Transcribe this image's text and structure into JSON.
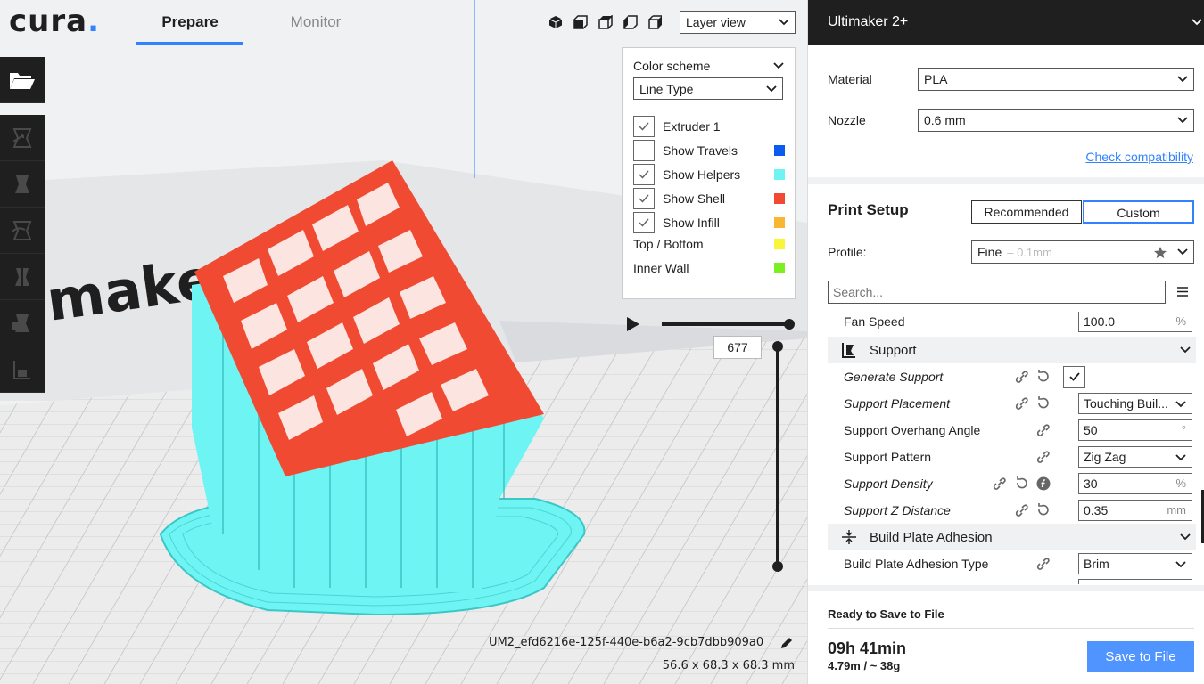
{
  "app": {
    "logo": "cura",
    "logo_dot": "."
  },
  "tabs": [
    {
      "label": "Prepare"
    },
    {
      "label": "Monitor"
    }
  ],
  "view": {
    "mode": "Layer view"
  },
  "legend": {
    "title": "Color scheme",
    "scheme": "Line Type",
    "items": [
      {
        "label": "Extruder 1",
        "checked": true,
        "color": ""
      },
      {
        "label": "Show Travels",
        "checked": false,
        "color": "#0a5cf0"
      },
      {
        "label": "Show Helpers",
        "checked": true,
        "color": "#6ff4f4"
      },
      {
        "label": "Show Shell",
        "checked": true,
        "color": "#f14a32"
      },
      {
        "label": "Show Infill",
        "checked": true,
        "color": "#f9b631"
      },
      {
        "label": "Top / Bottom",
        "checked": null,
        "color": "#f9f53a"
      },
      {
        "label": "Inner Wall",
        "checked": null,
        "color": "#7af021"
      }
    ]
  },
  "layer": {
    "current": "677"
  },
  "object": {
    "filename": "UM2_efd6216e-125f-440e-b6a2-9cb7dbb909a0",
    "dimensions": "56.6 x 68.3 x 68.3 mm"
  },
  "scene": {
    "plate_text": "maker"
  },
  "sidebar": {
    "machine": "Ultimaker 2+",
    "material_label": "Material",
    "material": "PLA",
    "nozzle_label": "Nozzle",
    "nozzle": "0.6 mm",
    "check_link": "Check compatibility",
    "print_setup": "Print Setup",
    "recommended": "Recommended",
    "custom": "Custom",
    "profile_label": "Profile:",
    "profile": "Fine",
    "profile_detail": "– 0.1mm",
    "search_placeholder": "Search...",
    "settings": [
      {
        "label": "Fan Speed",
        "value": "100.0",
        "unit": "%"
      },
      {
        "label": "Support"
      },
      {
        "label": "Generate Support"
      },
      {
        "label": "Support Placement",
        "value": "Touching Buil..."
      },
      {
        "label": "Support Overhang Angle",
        "value": "50",
        "unit": "°"
      },
      {
        "label": "Support Pattern",
        "value": "Zig Zag"
      },
      {
        "label": "Support Density",
        "value": "30",
        "unit": "%"
      },
      {
        "label": "Support Z Distance",
        "value": "0.35",
        "unit": "mm"
      },
      {
        "label": "Build Plate Adhesion"
      },
      {
        "label": "Build Plate Adhesion Type",
        "value": "Brim"
      }
    ],
    "ready_label": "Ready to Save to File",
    "time": "09h 41min",
    "usage": "4.79m / ~ 38g",
    "save_button": "Save to File"
  },
  "colors": {
    "accent": "#3282ff",
    "helper": "#6ff4f4",
    "shell": "#f14a32",
    "dark": "#1f1f1f"
  }
}
